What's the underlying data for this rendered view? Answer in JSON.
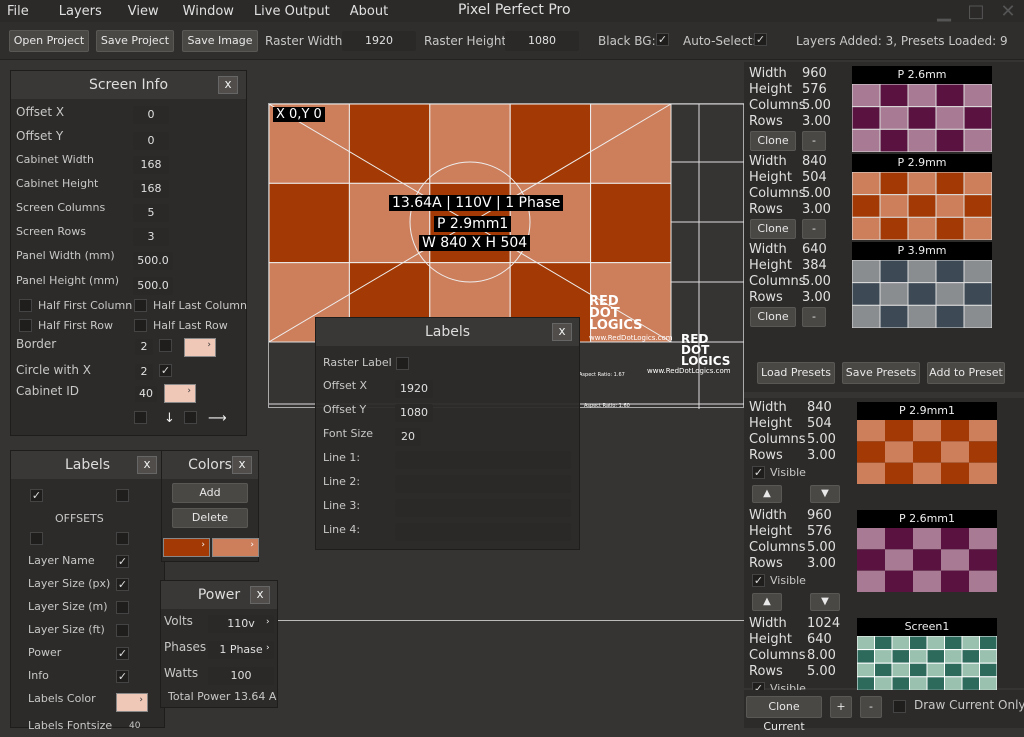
{
  "menu": [
    "File",
    "Layers",
    "View",
    "Window",
    "Live Output",
    "About"
  ],
  "app_title": "Pixel Perfect Pro",
  "toolbar": {
    "open": "Open Project",
    "save_project": "Save Project",
    "save_image": "Save Image",
    "raster_w_label": "Raster Width:",
    "raster_w": "1920",
    "raster_h_label": "Raster Height:",
    "raster_h": "1080",
    "black_bg": "Black BG:",
    "auto_select": "Auto-Select:",
    "status": "Layers Added: 3, Presets Loaded: 9"
  },
  "screen_info": {
    "title": "Screen Info",
    "x": "x",
    "offset_x_label": "Offset X",
    "offset_x": "0",
    "offset_y_label": "Offset Y",
    "offset_y": "0",
    "cab_w_label": "Cabinet Width",
    "cab_w": "168",
    "cab_h_label": "Cabinet Height",
    "cab_h": "168",
    "cols_label": "Screen Columns",
    "cols": "5",
    "rows_label": "Screen Rows",
    "rows": "3",
    "panel_w_label": "Panel Width  (mm)",
    "panel_w": "500.0",
    "panel_h_label": "Panel Height (mm)",
    "panel_h": "500.0",
    "half_first_col": "Half First Column",
    "half_last_col": "Half Last Column",
    "half_first_row": "Half First Row",
    "half_last_row": "Half Last Row",
    "border_label": "Border",
    "border": "2",
    "circle_label": "Circle with X",
    "circle": "2",
    "cabid_label": "Cabinet ID",
    "cabid": "40"
  },
  "labels_panel": {
    "title": "Labels",
    "x": "x",
    "offsets": "OFFSETS",
    "layer_name": "Layer Name",
    "layer_size_px": "Layer Size (px)",
    "layer_size_m": "Layer Size (m)",
    "layer_size_ft": "Layer Size (ft)",
    "power": "Power",
    "info": "Info",
    "labels_color": "Labels Color",
    "labels_fontsize": "Labels Fontsize",
    "fontsize_val": "40"
  },
  "colors_panel": {
    "title": "Colors",
    "x": "x",
    "add": "Add",
    "delete": "Delete"
  },
  "power_panel": {
    "title": "Power",
    "x": "x",
    "volts_label": "Volts",
    "volts": "110v",
    "phases_label": "Phases",
    "phases": "1 Phase",
    "watts_label": "Watts",
    "watts": "100",
    "total": "Total Power 13.64 A"
  },
  "labels_float": {
    "title": "Labels",
    "x": "x",
    "raster_label": "Raster Label",
    "offset_x_label": "Offset X",
    "offset_x": "1920",
    "offset_y_label": "Offset Y",
    "offset_y": "1080",
    "font_size_label": "Font Size",
    "font_size": "20",
    "line1": "Line 1:",
    "line2": "Line 2:",
    "line3": "Line 3:",
    "line4": "Line 4:"
  },
  "canvas": {
    "corner": "X 0,Y 0",
    "info_line1": "13.64A | 110V | 1 Phase",
    "info_line2": "P 2.9mm1",
    "info_line3": "W 840 X H 504",
    "logo1": "RED",
    "logo2": "DOT",
    "logo3": "LOGICS",
    "logo_url": "www.RedDotLogics.com",
    "aspect1": "Aspect Ratio: 1.67",
    "aspect2": "Aspect Ratio: 1.60"
  },
  "presets": [
    {
      "w_label": "Width",
      "w": "960",
      "h_label": "Height",
      "h": "576",
      "c_label": "Columns",
      "c": "5.00",
      "r_label": "Rows",
      "r": "3.00",
      "title": "P 2.6mm",
      "clone": "Clone",
      "minus": "-"
    },
    {
      "w_label": "Width",
      "w": "840",
      "h_label": "Height",
      "h": "504",
      "c_label": "Columns",
      "c": "5.00",
      "r_label": "Rows",
      "r": "3.00",
      "title": "P 2.9mm",
      "clone": "Clone",
      "minus": "-"
    },
    {
      "w_label": "Width",
      "w": "640",
      "h_label": "Height",
      "h": "384",
      "c_label": "Columns",
      "c": "5.00",
      "r_label": "Rows",
      "r": "3.00",
      "title": "P 3.9mm",
      "clone": "Clone",
      "minus": "-"
    }
  ],
  "preset_buttons": {
    "load": "Load Presets",
    "save": "Save Presets",
    "add": "Add to Preset"
  },
  "layers": [
    {
      "w_label": "Width",
      "w": "840",
      "h_label": "Height",
      "h": "504",
      "c_label": "Columns",
      "c": "5.00",
      "r_label": "Rows",
      "r": "3.00",
      "visible": "Visible",
      "title": "P 2.9mm1"
    },
    {
      "w_label": "Width",
      "w": "960",
      "h_label": "Height",
      "h": "576",
      "c_label": "Columns",
      "c": "5.00",
      "r_label": "Rows",
      "r": "3.00",
      "visible": "Visible",
      "title": "P 2.6mm1"
    },
    {
      "w_label": "Width",
      "w": "1024",
      "h_label": "Height",
      "h": "640",
      "c_label": "Columns",
      "c": "8.00",
      "r_label": "Rows",
      "r": "5.00",
      "visible": "Visible",
      "title": "Screen1"
    }
  ],
  "bottom": {
    "clone_current": "Clone Current",
    "plus": "+",
    "minus": "-",
    "draw_current": "Draw Current Only"
  },
  "colors": {
    "orange_dark": "#a33a05",
    "orange_light": "#cd7e5b",
    "purple_dark": "#5a1340",
    "purple_light": "#a87a94",
    "gray_dark": "#3d4a55",
    "gray_light": "#8a8d90",
    "teal_dark": "#2e6a5c",
    "teal_light": "#9ac1b0"
  }
}
